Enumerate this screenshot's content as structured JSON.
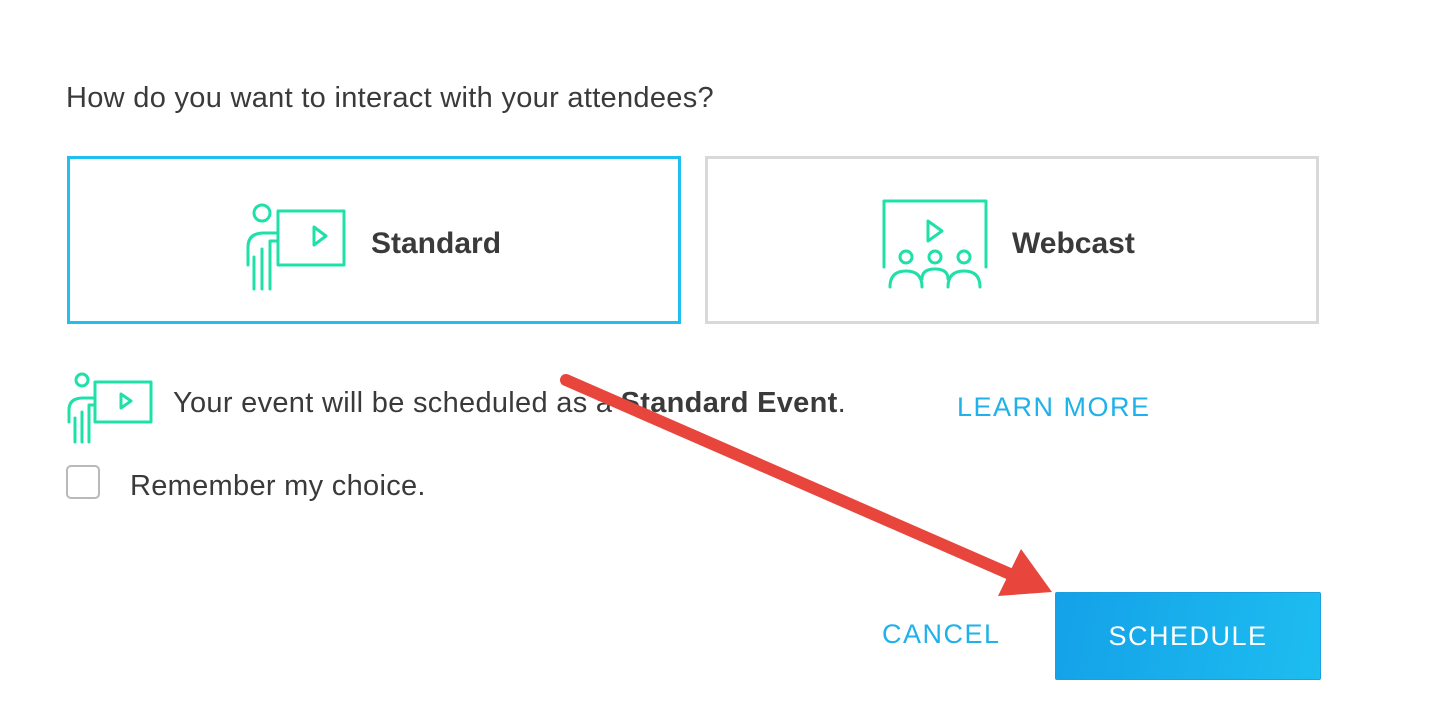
{
  "question": "How do you want to interact with your attendees?",
  "options": [
    {
      "label": "Standard",
      "icon": "presenter-screen-icon",
      "selected": true
    },
    {
      "label": "Webcast",
      "icon": "webcast-audience-icon",
      "selected": false
    }
  ],
  "info": {
    "prefix": "Your event will be scheduled as a ",
    "emphasis": "Standard Event",
    "suffix": ".",
    "learn_more": "LEARN MORE"
  },
  "remember": {
    "label": "Remember my choice.",
    "checked": false
  },
  "actions": {
    "cancel": "CANCEL",
    "schedule": "SCHEDULE"
  },
  "colors": {
    "accent": "#1fc0ef",
    "icon_green": "#1fe0a8",
    "annotation_arrow": "#e8453c",
    "text": "#3a3a3a"
  }
}
